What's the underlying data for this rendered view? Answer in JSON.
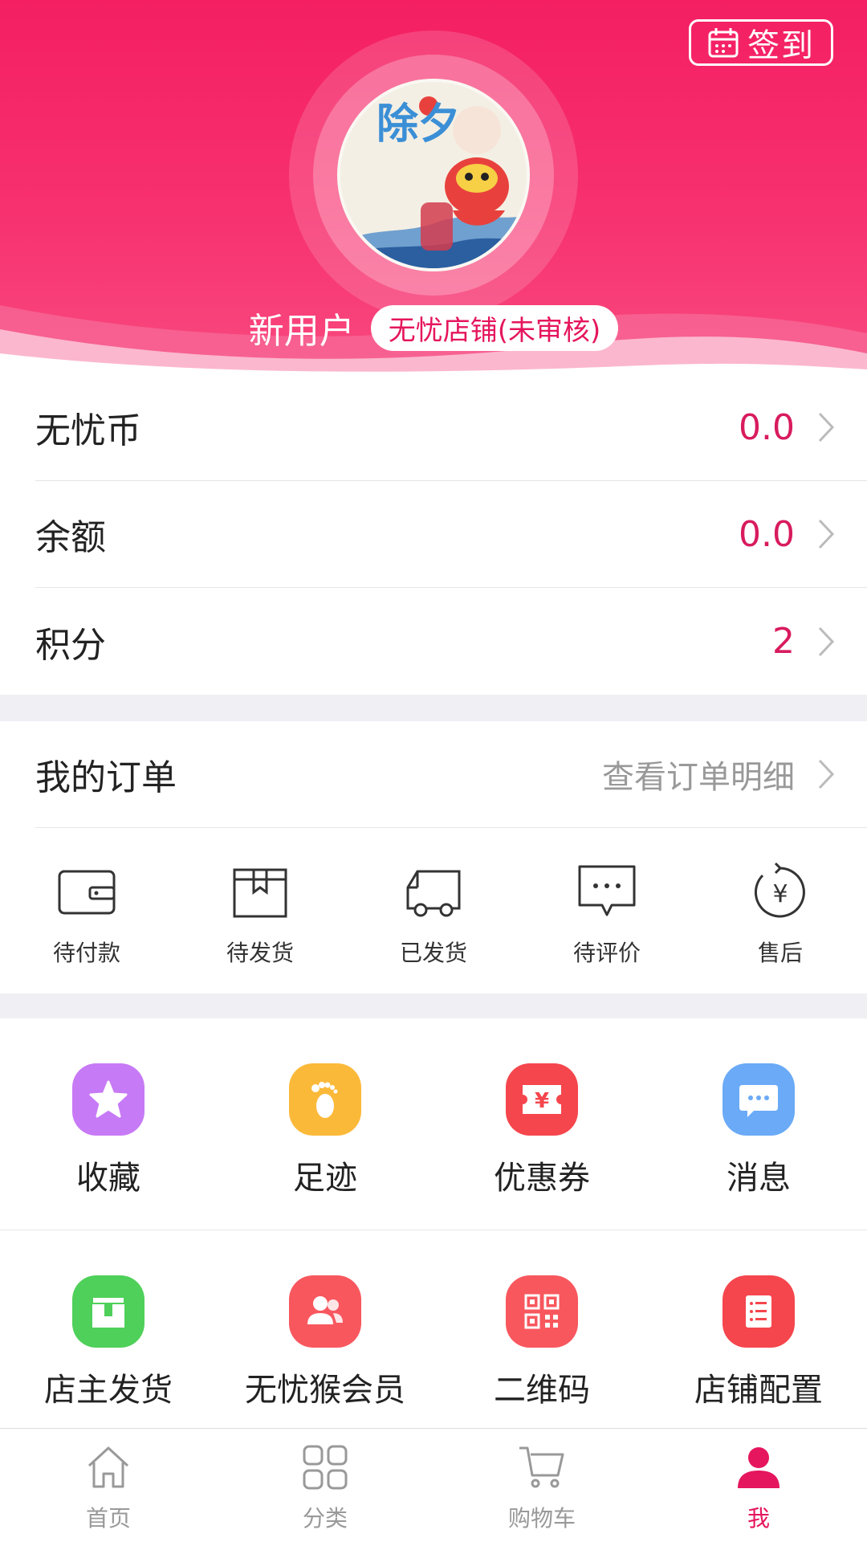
{
  "header": {
    "checkin_label": "签到",
    "username": "新用户",
    "shop_badge": "无忧店铺(未审核)",
    "avatar_text": "除夕"
  },
  "accounts": [
    {
      "label": "无忧币",
      "value": "0.0"
    },
    {
      "label": "余额",
      "value": "0.0"
    },
    {
      "label": "积分",
      "value": "2"
    }
  ],
  "orders": {
    "title": "我的订单",
    "link": "查看订单明细",
    "items": [
      {
        "label": "待付款",
        "icon": "wallet-icon"
      },
      {
        "label": "待发货",
        "icon": "box-icon"
      },
      {
        "label": "已发货",
        "icon": "truck-icon"
      },
      {
        "label": "待评价",
        "icon": "comment-icon"
      },
      {
        "label": "售后",
        "icon": "refund-icon"
      }
    ]
  },
  "tools": [
    {
      "label": "收藏",
      "icon": "star-icon",
      "color": "#c77af5"
    },
    {
      "label": "足迹",
      "icon": "footprint-icon",
      "color": "#fbb93a"
    },
    {
      "label": "优惠券",
      "icon": "coupon-icon",
      "color": "#f5464d"
    },
    {
      "label": "消息",
      "icon": "message-icon",
      "color": "#6aaaf6"
    },
    {
      "label": "店主发货",
      "icon": "ship-icon",
      "color": "#4fd05a"
    },
    {
      "label": "无忧猴会员",
      "icon": "members-icon",
      "color": "#f8575e"
    },
    {
      "label": "二维码",
      "icon": "qrcode-icon",
      "color": "#f8575e"
    },
    {
      "label": "店铺配置",
      "icon": "list-icon",
      "color": "#f5464d"
    }
  ],
  "tabbar": [
    {
      "label": "首页",
      "icon": "home-icon"
    },
    {
      "label": "分类",
      "icon": "category-icon"
    },
    {
      "label": "购物车",
      "icon": "cart-icon"
    },
    {
      "label": "我",
      "icon": "user-icon",
      "active": true
    }
  ],
  "colors": {
    "brand": "#f41f63",
    "accent_text": "#d81b5e"
  }
}
